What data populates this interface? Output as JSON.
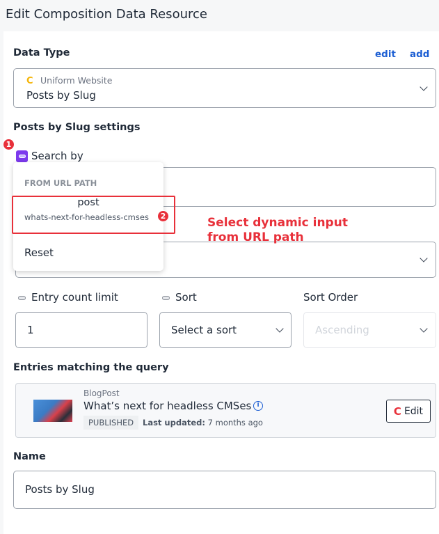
{
  "header": {
    "title": "Edit Composition Data Resource"
  },
  "data_type": {
    "label": "Data Type",
    "edit_label": "edit",
    "add_label": "add",
    "source": "Uniform Website",
    "value": "Posts by Slug"
  },
  "settings": {
    "heading": "Posts by Slug settings",
    "search_by_label": "Search by"
  },
  "dropdown": {
    "section_label": "FROM URL PATH",
    "option_name": "post",
    "option_value": "whats-next-for-headless-cmses",
    "reset_label": "Reset"
  },
  "annotations": {
    "badge1": "1",
    "badge2": "2",
    "callout_line1": "Select dynamic input",
    "callout_line2": "from URL path",
    "color": "#e8303a"
  },
  "filters": {
    "entry_count_label": "Entry count limit",
    "entry_count_value": "1",
    "sort_label": "Sort",
    "sort_value": "Select a sort",
    "sort_order_label": "Sort Order",
    "sort_order_value": "Ascending"
  },
  "entries": {
    "heading": "Entries matching the query",
    "items": [
      {
        "type": "BlogPost",
        "title": "What’s next for headless CMSes",
        "status": "PUBLISHED",
        "updated_label": "Last updated:",
        "updated_value": "7 months ago",
        "edit_label": "Edit"
      }
    ]
  },
  "name": {
    "label": "Name",
    "value": "Posts by Slug"
  }
}
